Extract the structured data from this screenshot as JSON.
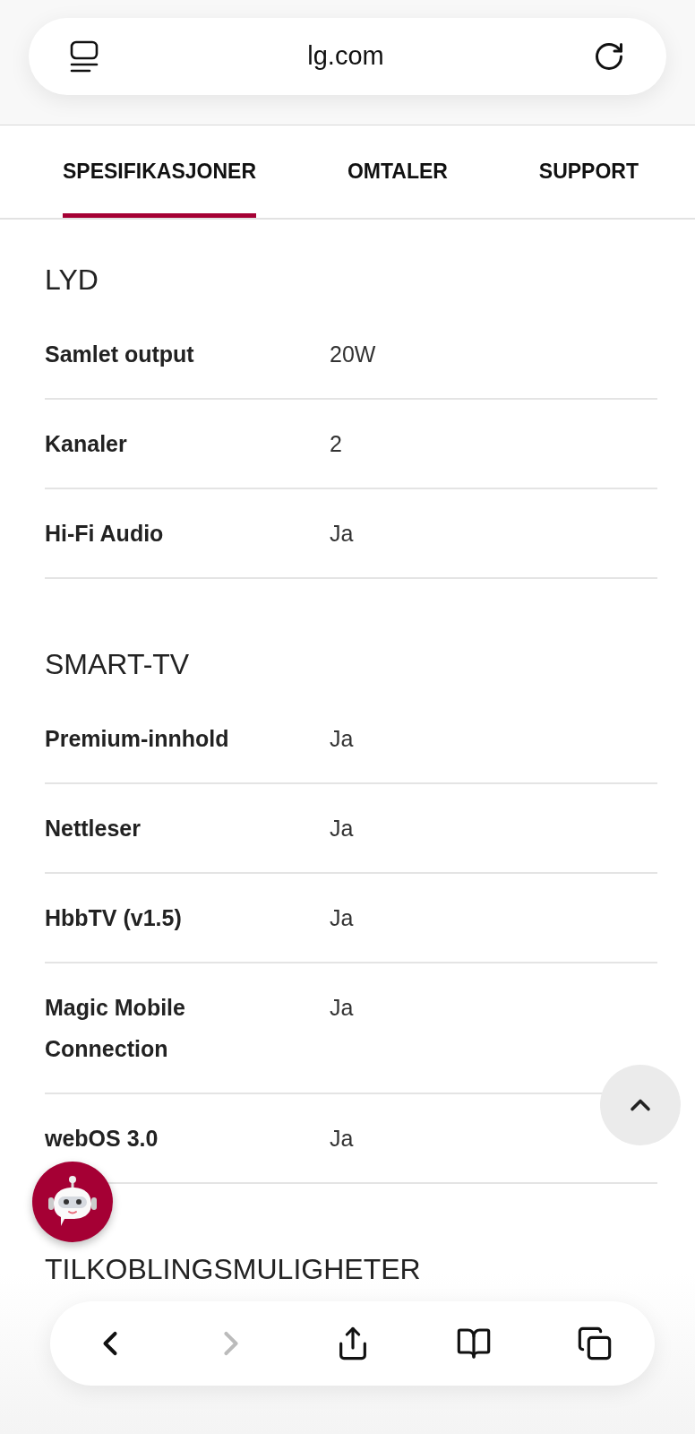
{
  "address_bar": {
    "url": "lg.com"
  },
  "tabs": [
    {
      "label": "SPESIFIKASJONER",
      "selected": true
    },
    {
      "label": "OMTALER",
      "selected": false
    },
    {
      "label": "SUPPORT",
      "selected": false
    }
  ],
  "sections": [
    {
      "title": "LYD",
      "rows": [
        {
          "label": "Samlet output",
          "value": "20W"
        },
        {
          "label": "Kanaler",
          "value": "2"
        },
        {
          "label": "Hi-Fi Audio",
          "value": "Ja"
        }
      ]
    },
    {
      "title": "SMART-TV",
      "rows": [
        {
          "label": "Premium-innhold",
          "value": "Ja"
        },
        {
          "label": "Nettleser",
          "value": "Ja"
        },
        {
          "label": "HbbTV (v1.5)",
          "value": "Ja"
        },
        {
          "label": "Magic Mobile Connection",
          "value": "Ja"
        },
        {
          "label": "webOS 3.0",
          "value": "Ja"
        }
      ]
    },
    {
      "title": "TILKOBLINGSMULIGHETER"
    }
  ],
  "toolbar": [
    {
      "kind": "back",
      "disabled": false
    },
    {
      "kind": "forward",
      "disabled": true
    },
    {
      "kind": "share",
      "disabled": false
    },
    {
      "kind": "bookmarks",
      "disabled": false
    },
    {
      "kind": "tabs",
      "disabled": false
    }
  ]
}
